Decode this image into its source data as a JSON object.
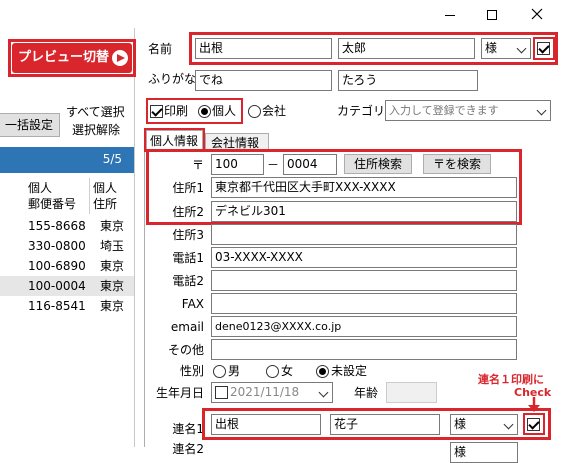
{
  "window": {
    "minimize_icon": "minimize-icon",
    "maximize_icon": "maximize-icon",
    "close_icon": "close-icon"
  },
  "preview_button": {
    "label": "プレビュー切替",
    "icon": "play-circle-icon"
  },
  "left_panel": {
    "bulk_settings": "一括設定",
    "select_all": "すべて選択",
    "deselect": "選択解除",
    "count": "5/5",
    "col1_header_line1": "個人",
    "col1_header_line2": "郵便番号",
    "col2_header_line1": "個人",
    "col2_header_line2": "住所",
    "rows": [
      {
        "zip": "155-8668",
        "addr": "東京"
      },
      {
        "zip": "330-0800",
        "addr": "埼玉"
      },
      {
        "zip": "100-6890",
        "addr": "東京"
      },
      {
        "zip": "100-0004",
        "addr": "東京"
      },
      {
        "zip": "116-8541",
        "addr": "東京"
      }
    ]
  },
  "name": {
    "label": "名前",
    "last": "出根",
    "first": "太郎",
    "honorific": "様",
    "checked": true,
    "furigana_label": "ふりがな",
    "furigana_last": "でね",
    "furigana_first": "たろう"
  },
  "print_options": {
    "print_label": "印刷",
    "print_checked": true,
    "individual_label": "個人",
    "company_label": "会社",
    "category_label": "カテゴリ",
    "category_placeholder": "入力して登録できます"
  },
  "tabs": {
    "personal": "個人情報",
    "company": "会社情報"
  },
  "address": {
    "postal_label": "〒",
    "postal1": "100",
    "dash": "－",
    "postal2": "0004",
    "search_address_button": "住所検索",
    "search_postal_button": "〒を検索",
    "addr1_label": "住所1",
    "addr1": "東京都千代田区大手町XXX-XXXX",
    "addr2_label": "住所2",
    "addr2": "デネビル301",
    "addr3_label": "住所3",
    "addr3": ""
  },
  "contact": {
    "phone1_label": "電話1",
    "phone1": "03-XXXX-XXXX",
    "phone2_label": "電話2",
    "phone2": "",
    "fax_label": "FAX",
    "fax": "",
    "email_label": "email",
    "email": "dene0123@XXXX.co.jp",
    "other_label": "その他",
    "other": ""
  },
  "gender": {
    "label": "性別",
    "male": "男",
    "female": "女",
    "unset": "未設定"
  },
  "birthday": {
    "label": "生年月日",
    "value": "2021/11/18",
    "age_label": "年齢",
    "age": ""
  },
  "joint": {
    "label": "連名1",
    "last": "出根",
    "first": "花子",
    "honorific": "様",
    "checked": true,
    "label2": "連名2",
    "honorific2": "様"
  },
  "annotation": {
    "line1": "連名１印刷に",
    "line2": "Check"
  },
  "colors": {
    "accent_red": "#d9262c",
    "header_blue": "#2e75b6"
  }
}
